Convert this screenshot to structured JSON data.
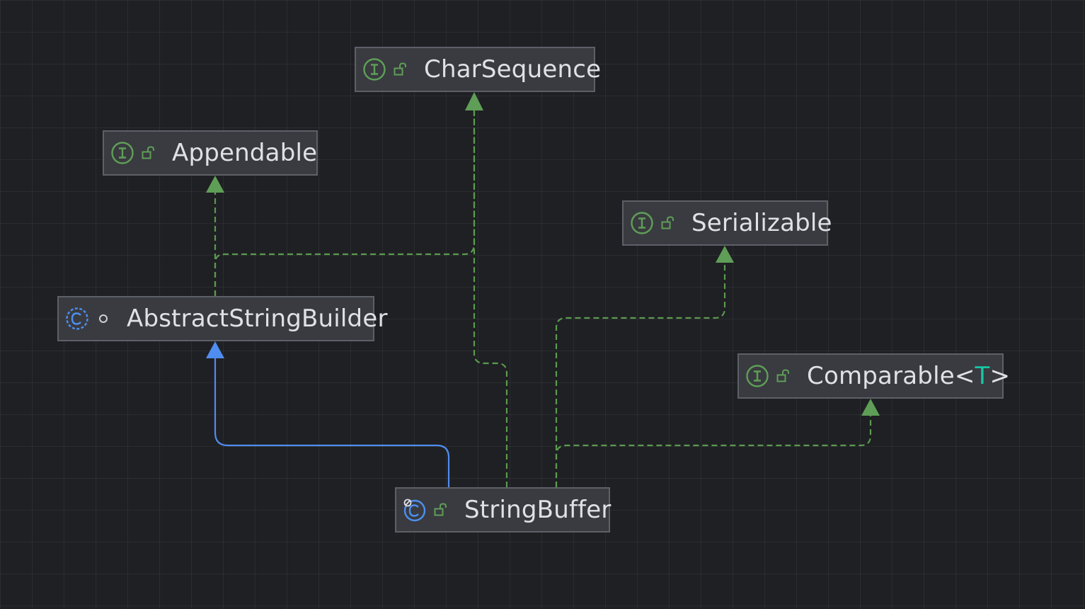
{
  "diagram": {
    "colors": {
      "background": "#1f2023",
      "node_fill": "#393b40",
      "node_border": "#5d6068",
      "interface_icon": "#5f9e57",
      "class_icon": "#4d8ff0",
      "implements_edge": "#5a9a4f",
      "extends_edge": "#4f8df0",
      "type_parameter": "#17c6a3"
    },
    "nodes": [
      {
        "id": "charsequence",
        "kind": "interface",
        "visibility": "public",
        "name": "CharSequence"
      },
      {
        "id": "appendable",
        "kind": "interface",
        "visibility": "public",
        "name": "Appendable"
      },
      {
        "id": "serializable",
        "kind": "interface",
        "visibility": "public",
        "name": "Serializable"
      },
      {
        "id": "abstractstringbuilder",
        "kind": "abstract-class",
        "visibility": "package-private",
        "name": "AbstractStringBuilder"
      },
      {
        "id": "comparable",
        "kind": "interface",
        "visibility": "public",
        "name": "Comparable",
        "generic_open": "<",
        "type_param": "T",
        "generic_close": ">"
      },
      {
        "id": "stringbuffer",
        "kind": "final-class",
        "visibility": "public",
        "name": "StringBuffer"
      }
    ],
    "edges": [
      {
        "from": "abstractstringbuilder",
        "to": "appendable",
        "relation": "implements"
      },
      {
        "from": "abstractstringbuilder",
        "to": "charsequence",
        "relation": "implements"
      },
      {
        "from": "stringbuffer",
        "to": "abstractstringbuilder",
        "relation": "extends"
      },
      {
        "from": "stringbuffer",
        "to": "charsequence",
        "relation": "implements"
      },
      {
        "from": "stringbuffer",
        "to": "serializable",
        "relation": "implements"
      },
      {
        "from": "stringbuffer",
        "to": "comparable",
        "relation": "implements"
      }
    ]
  }
}
